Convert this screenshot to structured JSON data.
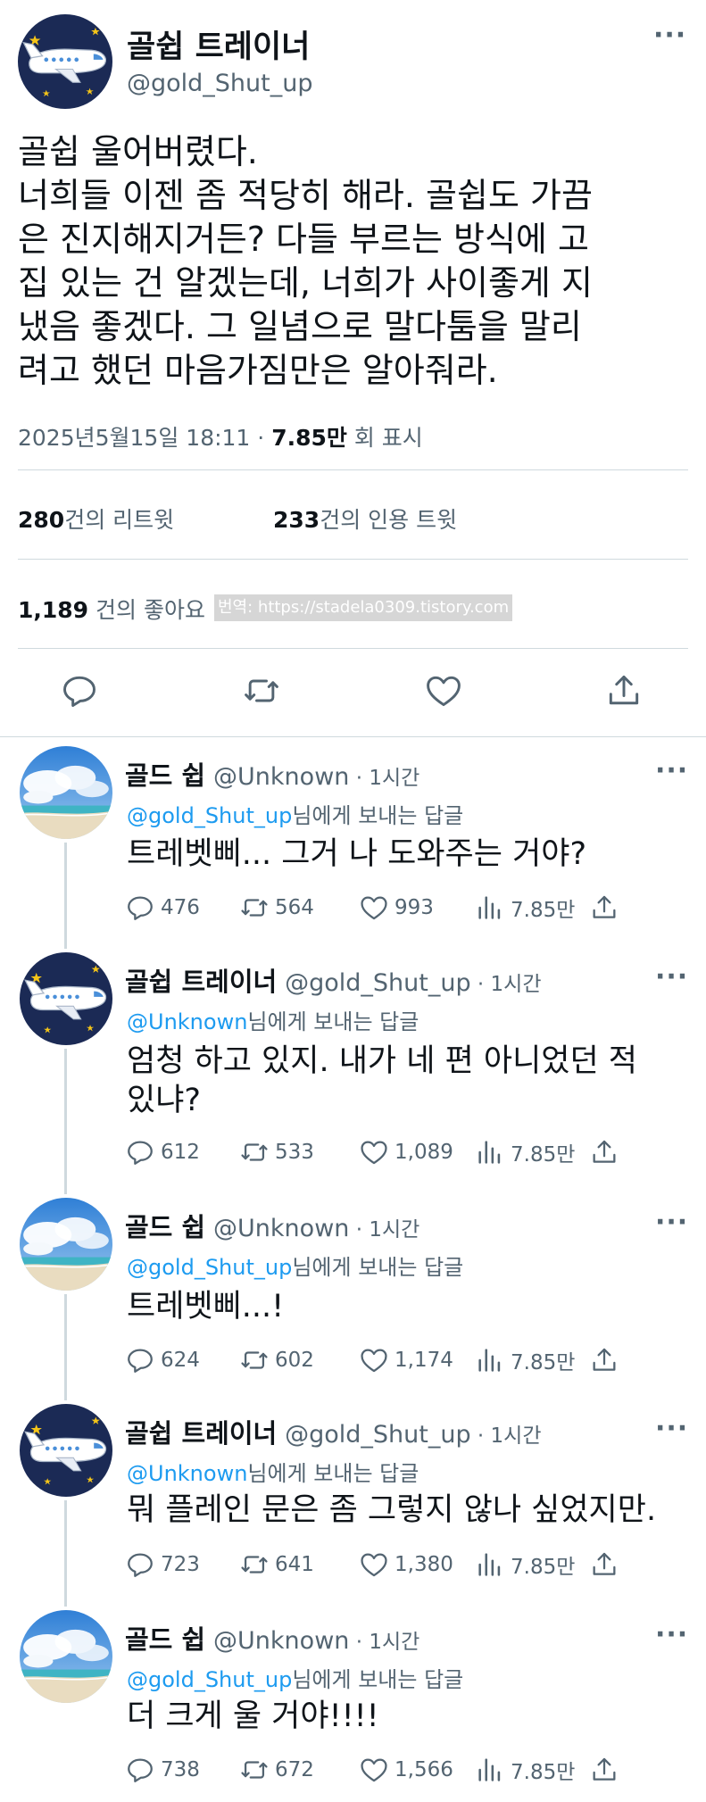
{
  "main_tweet": {
    "display_name": "골쉽 트레이너",
    "handle": "@gold_Shut_up",
    "more": "···",
    "text_lines": [
      "골쉽 울어버렸다.",
      "너희들 이젠 좀 적당히 해라. 골쉽도 가끔",
      "은 진지해지거든? 다들 부르는 방식에 고",
      "집 있는 건 알겠는데, 너희가 사이좋게 지",
      "냈음 좋겠다. 그 일념으로 말다툼을 말리",
      "려고 했던 마음가짐만은 알아줘라."
    ],
    "timestamp": "2025년5월15일 18:11 · ",
    "views_value": "7.85만",
    "views_label": " 회 표시",
    "retweets_count": "280",
    "retweets_label": "건의 리트윗",
    "quotes_count": "233",
    "quotes_label": "건의 인용 트윗",
    "likes_count": "1,189",
    "likes_label": " 건의 좋아요",
    "translation_watermark": "번역: https://stadela0309.tistory.com",
    "actions": [
      "reply-icon",
      "retweet-icon",
      "like-icon",
      "share-icon"
    ]
  },
  "replies": [
    {
      "avatar": "beach",
      "name": "골드 쉽",
      "handle": "@Unknown",
      "time": " · 1시간",
      "reply_to_handle": "@gold_Shut_up",
      "reply_to_suffix": "님에게 보내는 답글",
      "text_lines": [
        "트레벳삐... 그거 나 도와주는 거야?"
      ],
      "replies": "476",
      "retweets": "564",
      "likes": "993",
      "views": "7.85만"
    },
    {
      "avatar": "plane",
      "name": "골쉽 트레이너",
      "handle": "@gold_Shut_up",
      "time": " · 1시간",
      "reply_to_handle": "@Unknown",
      "reply_to_suffix": "님에게 보내는 답글",
      "text_lines": [
        "엄청 하고 있지. 내가 네 편 아니었던 적",
        "있냐?"
      ],
      "replies": "612",
      "retweets": "533",
      "likes": "1,089",
      "views": "7.85만"
    },
    {
      "avatar": "beach",
      "name": "골드 쉽",
      "handle": "@Unknown",
      "time": " · 1시간 ",
      "reply_to_handle": "@gold_Shut_up",
      "reply_to_suffix": "님에게 보내는 답글",
      "text_lines": [
        "트레벳삐...!"
      ],
      "replies": "624",
      "retweets": "602",
      "likes": "1,174",
      "views": "7.85만"
    },
    {
      "avatar": "plane",
      "name": "골쉽 트레이너",
      "handle": "@gold_Shut_up",
      "time": " · 1시간",
      "reply_to_handle": "@Unknown",
      "reply_to_suffix": "님에게 보내는 답글",
      "text_lines": [
        "뭐 플레인 문은 좀 그렇지 않나 싶었지만."
      ],
      "replies": "723",
      "retweets": "641",
      "likes": "1,380",
      "views": "7.85만"
    },
    {
      "avatar": "beach",
      "name": "골드 쉽",
      "handle": "@Unknown",
      "time": " · 1시간",
      "reply_to_handle": "@gold_Shut_up",
      "reply_to_suffix": "님에게 보내는 답글",
      "text_lines": [
        "더 크게 울 거야!!!!"
      ],
      "replies": "738",
      "retweets": "672",
      "likes": "1,566",
      "views": "7.85만"
    }
  ],
  "colors": {
    "text": "#0f1419",
    "secondary": "#536471",
    "link": "#1d9bf0",
    "divider": "#cfd9de",
    "avatar_navy": "#1b2a55"
  }
}
